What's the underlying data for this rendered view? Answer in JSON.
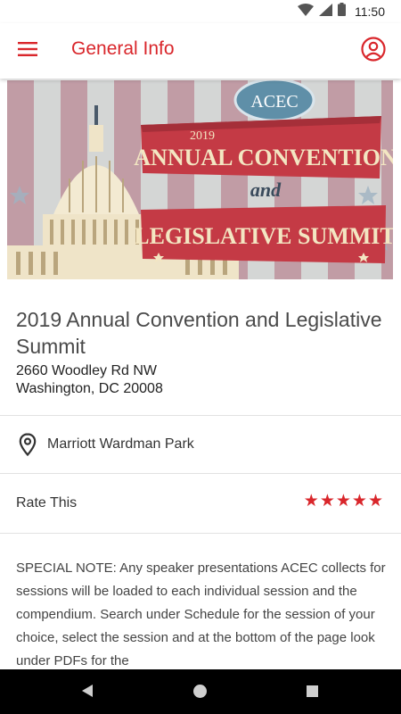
{
  "status_bar": {
    "time": "11:50",
    "icons": [
      "wifi-icon",
      "signal-icon",
      "battery-icon"
    ]
  },
  "app_bar": {
    "title": "General Info",
    "menu_icon": "hamburger-menu-icon",
    "profile_icon": "account-circle-icon"
  },
  "banner": {
    "logo_text": "ACEC",
    "year": "2019",
    "line1": "ANNUAL CONVENTION",
    "conjunction": "and",
    "line2": "LEGISLATIVE SUMMIT"
  },
  "event": {
    "title": "2019 Annual Convention and Legislative Summit",
    "address_line1": "2660 Woodley Rd NW",
    "address_line2": "Washington, DC 20008"
  },
  "location": {
    "icon": "location-pin-icon",
    "name": "Marriott Wardman Park"
  },
  "rating": {
    "label": "Rate This",
    "stars": 5,
    "filled": 5
  },
  "note": {
    "text": "SPECIAL NOTE: Any speaker presentations ACEC collects for sessions will be loaded to each individual session and the compendium. Search under Schedule for the session of your choice, select the session and at the bottom of the page look under PDFs for the"
  },
  "colors": {
    "accent": "#d9262b",
    "text": "#4a4a4a",
    "divider": "#e2e2e2"
  }
}
